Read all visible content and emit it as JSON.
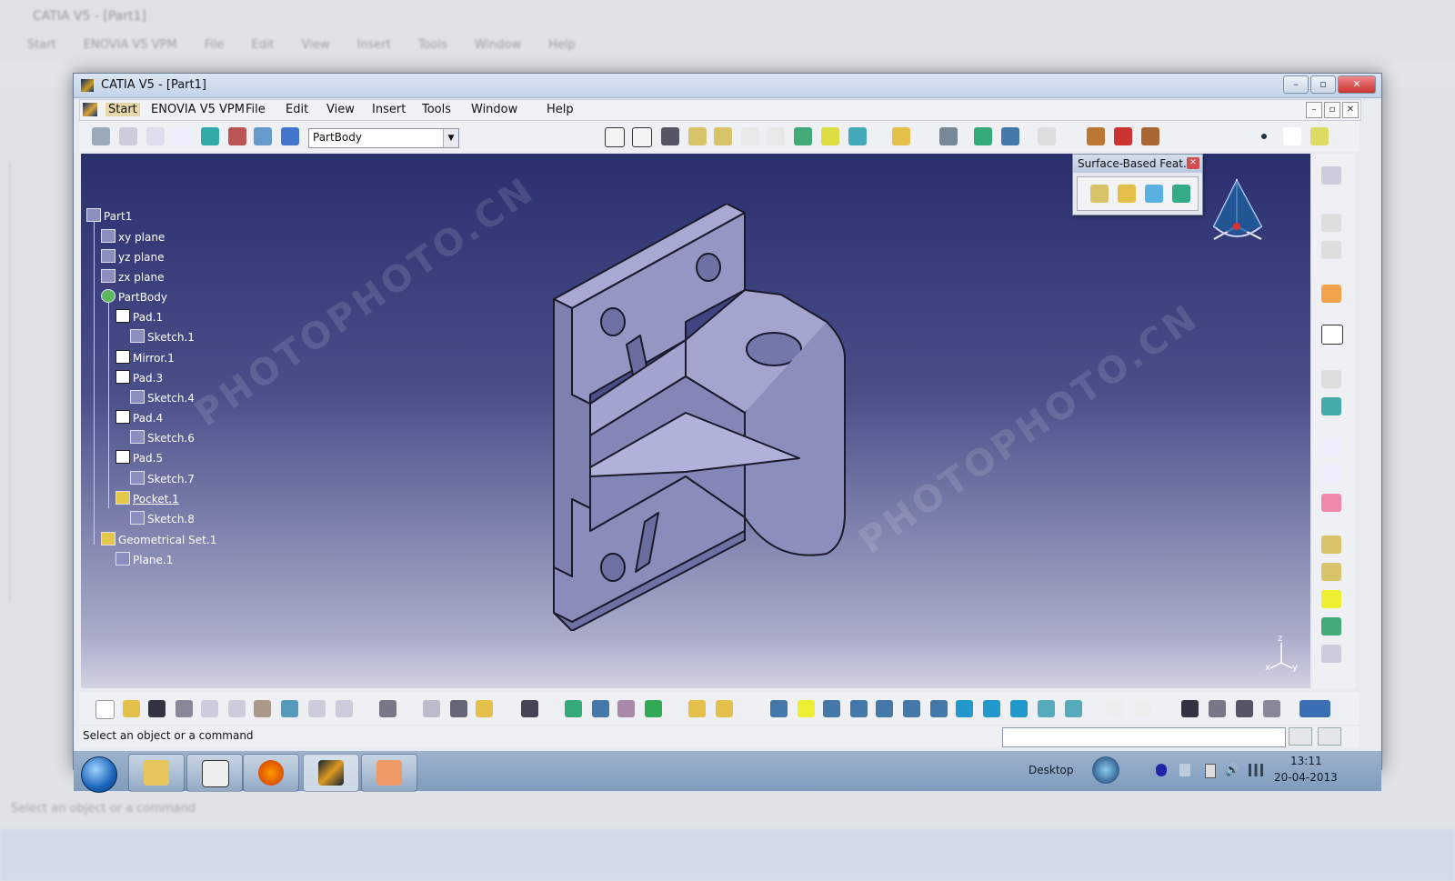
{
  "window": {
    "title": "CATIA V5 - [Part1]"
  },
  "menu": {
    "items": [
      "Start",
      "ENOVIA V5 VPM",
      "File",
      "Edit",
      "View",
      "Insert",
      "Tools",
      "Window",
      "Help"
    ]
  },
  "toolbar": {
    "body_selector": "PartBody"
  },
  "tree": {
    "root": "Part1",
    "nodes": [
      {
        "label": "xy plane",
        "icon": "plane-icon"
      },
      {
        "label": "yz plane",
        "icon": "plane-icon"
      },
      {
        "label": "zx plane",
        "icon": "plane-icon"
      },
      {
        "label": "PartBody",
        "icon": "partbody-icon"
      },
      {
        "label": "Pad.1",
        "icon": "pad-icon"
      },
      {
        "label": "Sketch.1",
        "icon": "sketch-icon"
      },
      {
        "label": "Mirror.1",
        "icon": "mirror-icon"
      },
      {
        "label": "Pad.3",
        "icon": "pad-icon"
      },
      {
        "label": "Sketch.4",
        "icon": "sketch-icon"
      },
      {
        "label": "Pad.4",
        "icon": "pad-icon"
      },
      {
        "label": "Sketch.6",
        "icon": "sketch-icon"
      },
      {
        "label": "Pad.5",
        "icon": "pad-icon"
      },
      {
        "label": "Sketch.7",
        "icon": "sketch-icon"
      },
      {
        "label": "Pocket.1",
        "icon": "pocket-icon"
      },
      {
        "label": "Sketch.8",
        "icon": "sketch-icon"
      },
      {
        "label": "Geometrical Set.1",
        "icon": "geoset-icon"
      },
      {
        "label": "Plane.1",
        "icon": "plane-icon"
      }
    ]
  },
  "floating_toolbar": {
    "title": "Surface-Based Feat..."
  },
  "status": {
    "message": "Select an object or a command"
  },
  "axes": {
    "z": "z",
    "x": "x",
    "y": "y"
  },
  "taskbar": {
    "desktop_label": "Desktop",
    "time": "13:11",
    "date": "20-04-2013"
  },
  "watermark": {
    "text": "PHOTOPHOTO.CN"
  },
  "colors": {
    "viewport_top": "#2a2f6e",
    "viewport_bottom": "#d2d3e2",
    "part_face": "#8f92c0",
    "part_edge": "#1a1a2a"
  }
}
